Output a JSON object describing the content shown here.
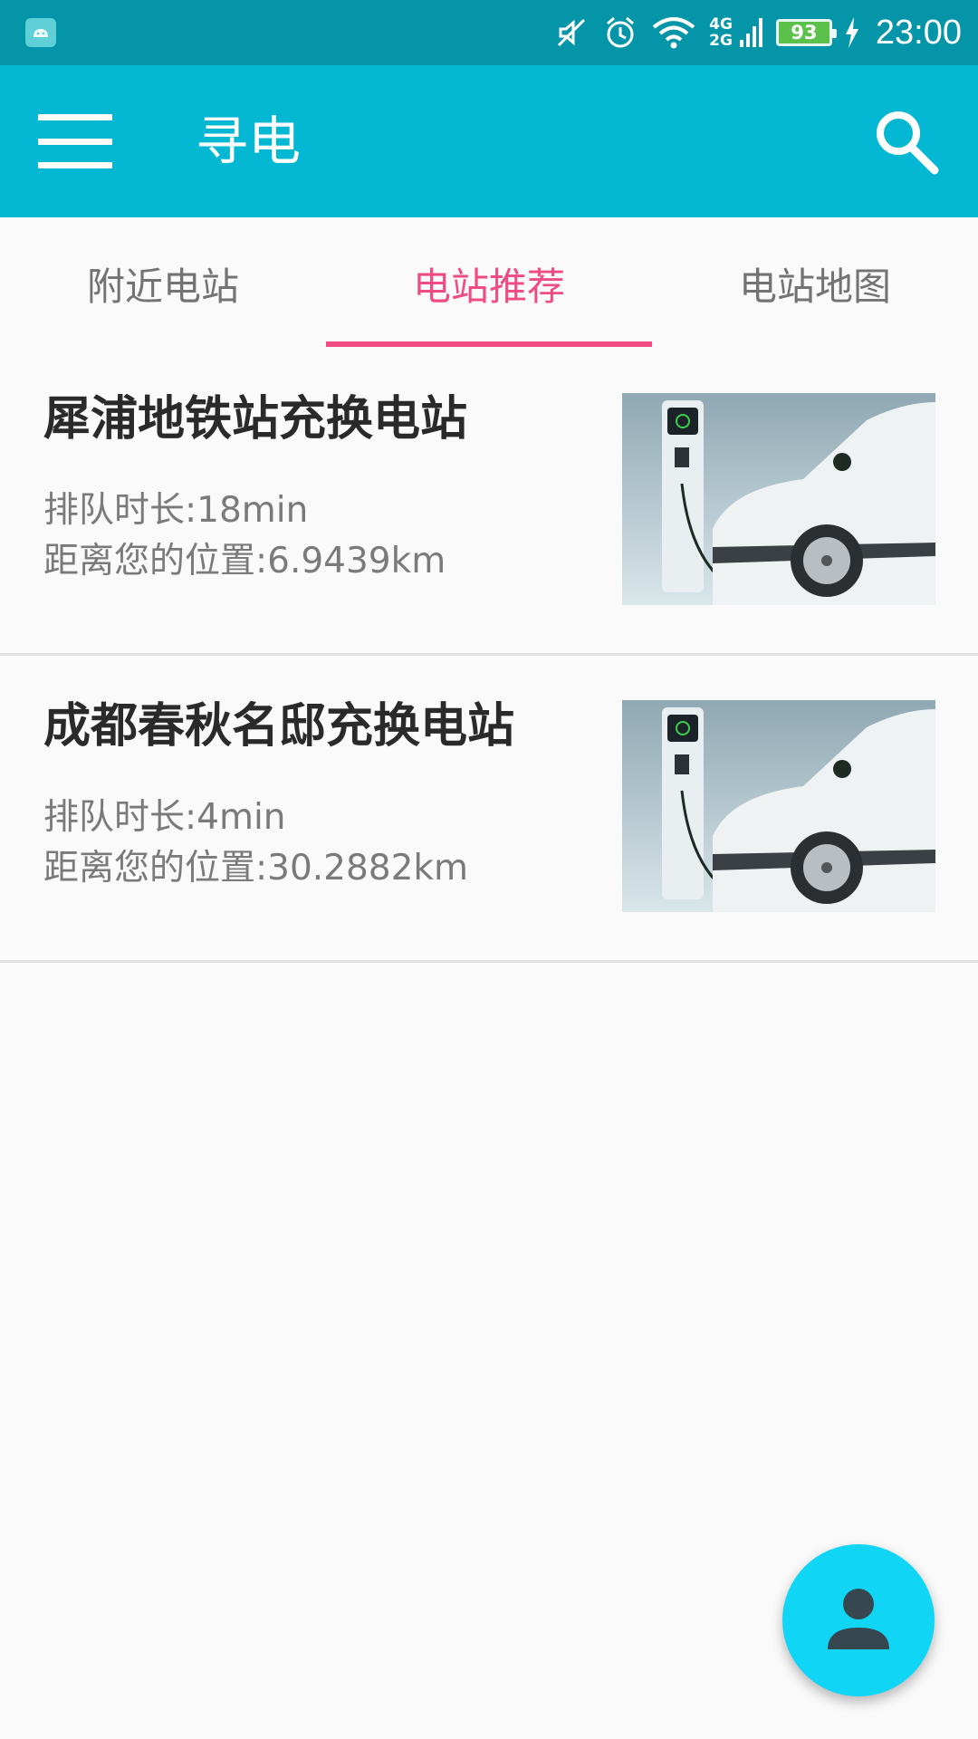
{
  "status_bar": {
    "network_top": "4G",
    "network_bottom": "2G",
    "battery_level": "93",
    "time": "23:00"
  },
  "app_bar": {
    "title": "寻电",
    "menu_icon": "hamburger-menu-icon",
    "search_icon": "search-icon"
  },
  "tabs": [
    {
      "label": "附近电站",
      "active": false
    },
    {
      "label": "电站推荐",
      "active": true
    },
    {
      "label": "电站地图",
      "active": false
    }
  ],
  "colors": {
    "status_bar": "#0496a8",
    "app_bar": "#04b8d3",
    "accent": "#ee4c83",
    "fab": "#10d5f5"
  },
  "stations": [
    {
      "name": "犀浦地铁站充换电站",
      "queue_label": "排队时长:",
      "queue_value": "18min",
      "distance_label": "距离您的位置:",
      "distance_value": "6.9439km"
    },
    {
      "name": "成都春秋名邸充换电站",
      "queue_label": "排队时长:",
      "queue_value": "4min",
      "distance_label": "距离您的位置:",
      "distance_value": "30.2882km"
    }
  ],
  "fab": {
    "icon": "person-icon"
  }
}
